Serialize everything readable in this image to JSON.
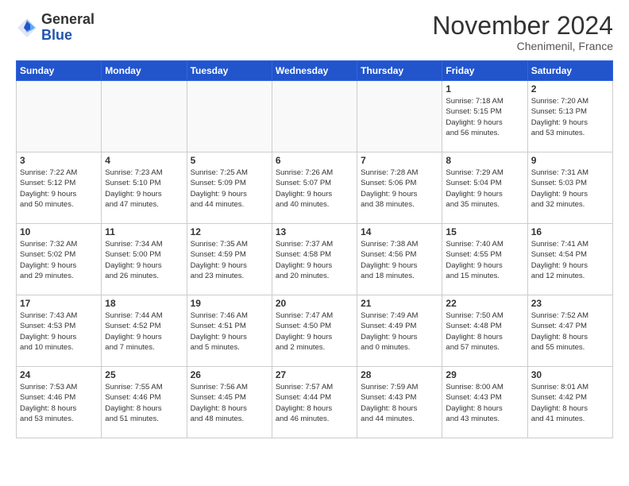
{
  "header": {
    "logo_general": "General",
    "logo_blue": "Blue",
    "month_title": "November 2024",
    "location": "Chenimenil, France"
  },
  "weekdays": [
    "Sunday",
    "Monday",
    "Tuesday",
    "Wednesday",
    "Thursday",
    "Friday",
    "Saturday"
  ],
  "weeks": [
    [
      {
        "day": "",
        "info": ""
      },
      {
        "day": "",
        "info": ""
      },
      {
        "day": "",
        "info": ""
      },
      {
        "day": "",
        "info": ""
      },
      {
        "day": "",
        "info": ""
      },
      {
        "day": "1",
        "info": "Sunrise: 7:18 AM\nSunset: 5:15 PM\nDaylight: 9 hours\nand 56 minutes."
      },
      {
        "day": "2",
        "info": "Sunrise: 7:20 AM\nSunset: 5:13 PM\nDaylight: 9 hours\nand 53 minutes."
      }
    ],
    [
      {
        "day": "3",
        "info": "Sunrise: 7:22 AM\nSunset: 5:12 PM\nDaylight: 9 hours\nand 50 minutes."
      },
      {
        "day": "4",
        "info": "Sunrise: 7:23 AM\nSunset: 5:10 PM\nDaylight: 9 hours\nand 47 minutes."
      },
      {
        "day": "5",
        "info": "Sunrise: 7:25 AM\nSunset: 5:09 PM\nDaylight: 9 hours\nand 44 minutes."
      },
      {
        "day": "6",
        "info": "Sunrise: 7:26 AM\nSunset: 5:07 PM\nDaylight: 9 hours\nand 40 minutes."
      },
      {
        "day": "7",
        "info": "Sunrise: 7:28 AM\nSunset: 5:06 PM\nDaylight: 9 hours\nand 38 minutes."
      },
      {
        "day": "8",
        "info": "Sunrise: 7:29 AM\nSunset: 5:04 PM\nDaylight: 9 hours\nand 35 minutes."
      },
      {
        "day": "9",
        "info": "Sunrise: 7:31 AM\nSunset: 5:03 PM\nDaylight: 9 hours\nand 32 minutes."
      }
    ],
    [
      {
        "day": "10",
        "info": "Sunrise: 7:32 AM\nSunset: 5:02 PM\nDaylight: 9 hours\nand 29 minutes."
      },
      {
        "day": "11",
        "info": "Sunrise: 7:34 AM\nSunset: 5:00 PM\nDaylight: 9 hours\nand 26 minutes."
      },
      {
        "day": "12",
        "info": "Sunrise: 7:35 AM\nSunset: 4:59 PM\nDaylight: 9 hours\nand 23 minutes."
      },
      {
        "day": "13",
        "info": "Sunrise: 7:37 AM\nSunset: 4:58 PM\nDaylight: 9 hours\nand 20 minutes."
      },
      {
        "day": "14",
        "info": "Sunrise: 7:38 AM\nSunset: 4:56 PM\nDaylight: 9 hours\nand 18 minutes."
      },
      {
        "day": "15",
        "info": "Sunrise: 7:40 AM\nSunset: 4:55 PM\nDaylight: 9 hours\nand 15 minutes."
      },
      {
        "day": "16",
        "info": "Sunrise: 7:41 AM\nSunset: 4:54 PM\nDaylight: 9 hours\nand 12 minutes."
      }
    ],
    [
      {
        "day": "17",
        "info": "Sunrise: 7:43 AM\nSunset: 4:53 PM\nDaylight: 9 hours\nand 10 minutes."
      },
      {
        "day": "18",
        "info": "Sunrise: 7:44 AM\nSunset: 4:52 PM\nDaylight: 9 hours\nand 7 minutes."
      },
      {
        "day": "19",
        "info": "Sunrise: 7:46 AM\nSunset: 4:51 PM\nDaylight: 9 hours\nand 5 minutes."
      },
      {
        "day": "20",
        "info": "Sunrise: 7:47 AM\nSunset: 4:50 PM\nDaylight: 9 hours\nand 2 minutes."
      },
      {
        "day": "21",
        "info": "Sunrise: 7:49 AM\nSunset: 4:49 PM\nDaylight: 9 hours\nand 0 minutes."
      },
      {
        "day": "22",
        "info": "Sunrise: 7:50 AM\nSunset: 4:48 PM\nDaylight: 8 hours\nand 57 minutes."
      },
      {
        "day": "23",
        "info": "Sunrise: 7:52 AM\nSunset: 4:47 PM\nDaylight: 8 hours\nand 55 minutes."
      }
    ],
    [
      {
        "day": "24",
        "info": "Sunrise: 7:53 AM\nSunset: 4:46 PM\nDaylight: 8 hours\nand 53 minutes."
      },
      {
        "day": "25",
        "info": "Sunrise: 7:55 AM\nSunset: 4:46 PM\nDaylight: 8 hours\nand 51 minutes."
      },
      {
        "day": "26",
        "info": "Sunrise: 7:56 AM\nSunset: 4:45 PM\nDaylight: 8 hours\nand 48 minutes."
      },
      {
        "day": "27",
        "info": "Sunrise: 7:57 AM\nSunset: 4:44 PM\nDaylight: 8 hours\nand 46 minutes."
      },
      {
        "day": "28",
        "info": "Sunrise: 7:59 AM\nSunset: 4:43 PM\nDaylight: 8 hours\nand 44 minutes."
      },
      {
        "day": "29",
        "info": "Sunrise: 8:00 AM\nSunset: 4:43 PM\nDaylight: 8 hours\nand 43 minutes."
      },
      {
        "day": "30",
        "info": "Sunrise: 8:01 AM\nSunset: 4:42 PM\nDaylight: 8 hours\nand 41 minutes."
      }
    ]
  ]
}
